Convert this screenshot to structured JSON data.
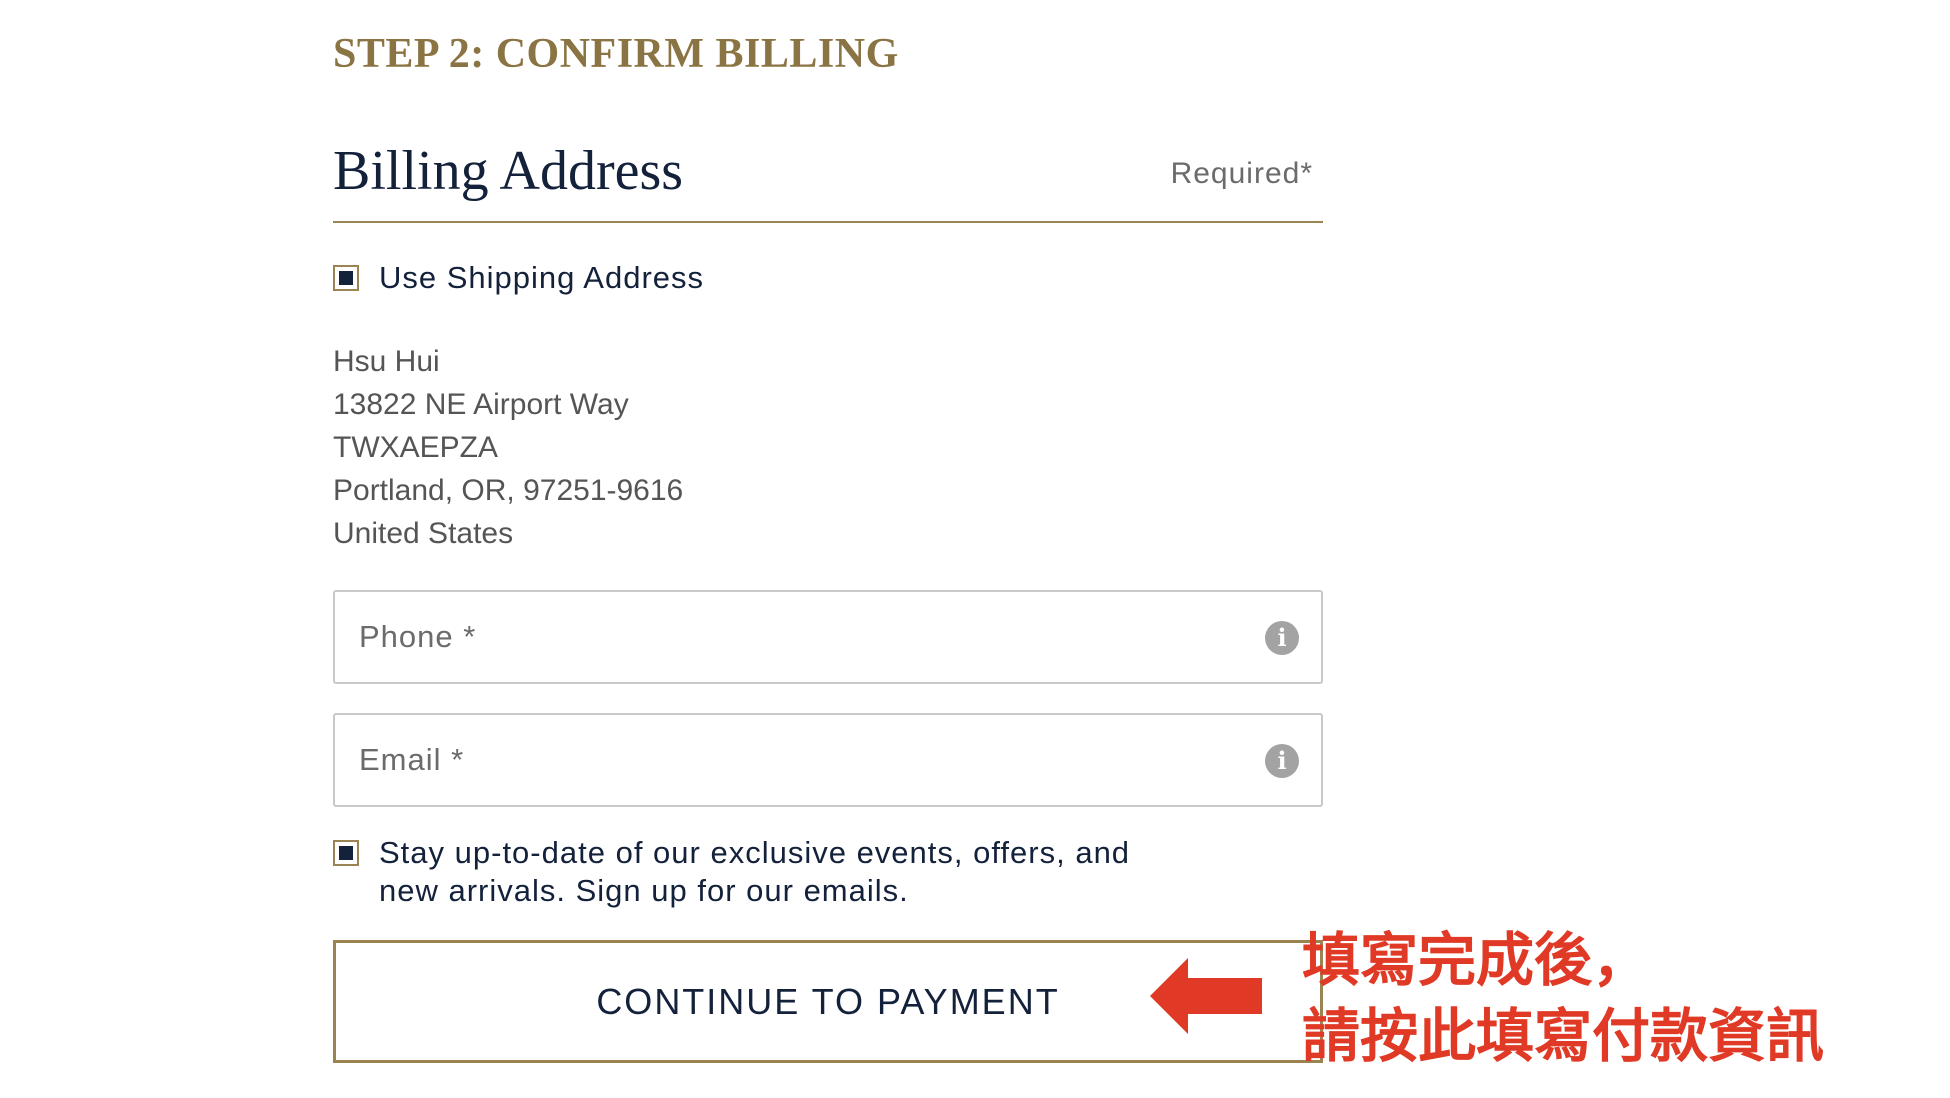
{
  "step": {
    "title": "STEP 2: CONFIRM BILLING"
  },
  "billing": {
    "title": "Billing Address",
    "required_note": "Required*",
    "use_shipping": {
      "label": "Use Shipping Address",
      "checked": true
    },
    "address": {
      "name": "Hsu Hui",
      "street": "13822 NE Airport Way",
      "line2": "TWXAEPZA",
      "city_state_zip": "Portland, OR, 97251-9616",
      "country": "United States"
    },
    "phone": {
      "placeholder": "Phone *",
      "value": ""
    },
    "email": {
      "placeholder": "Email *",
      "value": ""
    },
    "newsletter": {
      "line1": "Stay up-to-date of our exclusive events, offers, and",
      "line2": "new arrivals. Sign up for our emails.",
      "checked": true
    },
    "continue_label": "CONTINUE TO PAYMENT"
  },
  "annotation": {
    "line1": "填寫完成後，",
    "line2": "請按此填寫付款資訊",
    "color": "#e03a26"
  },
  "colors": {
    "accent_gold": "#8b7443",
    "navy": "#13213b",
    "border_gold": "#9a8552"
  }
}
